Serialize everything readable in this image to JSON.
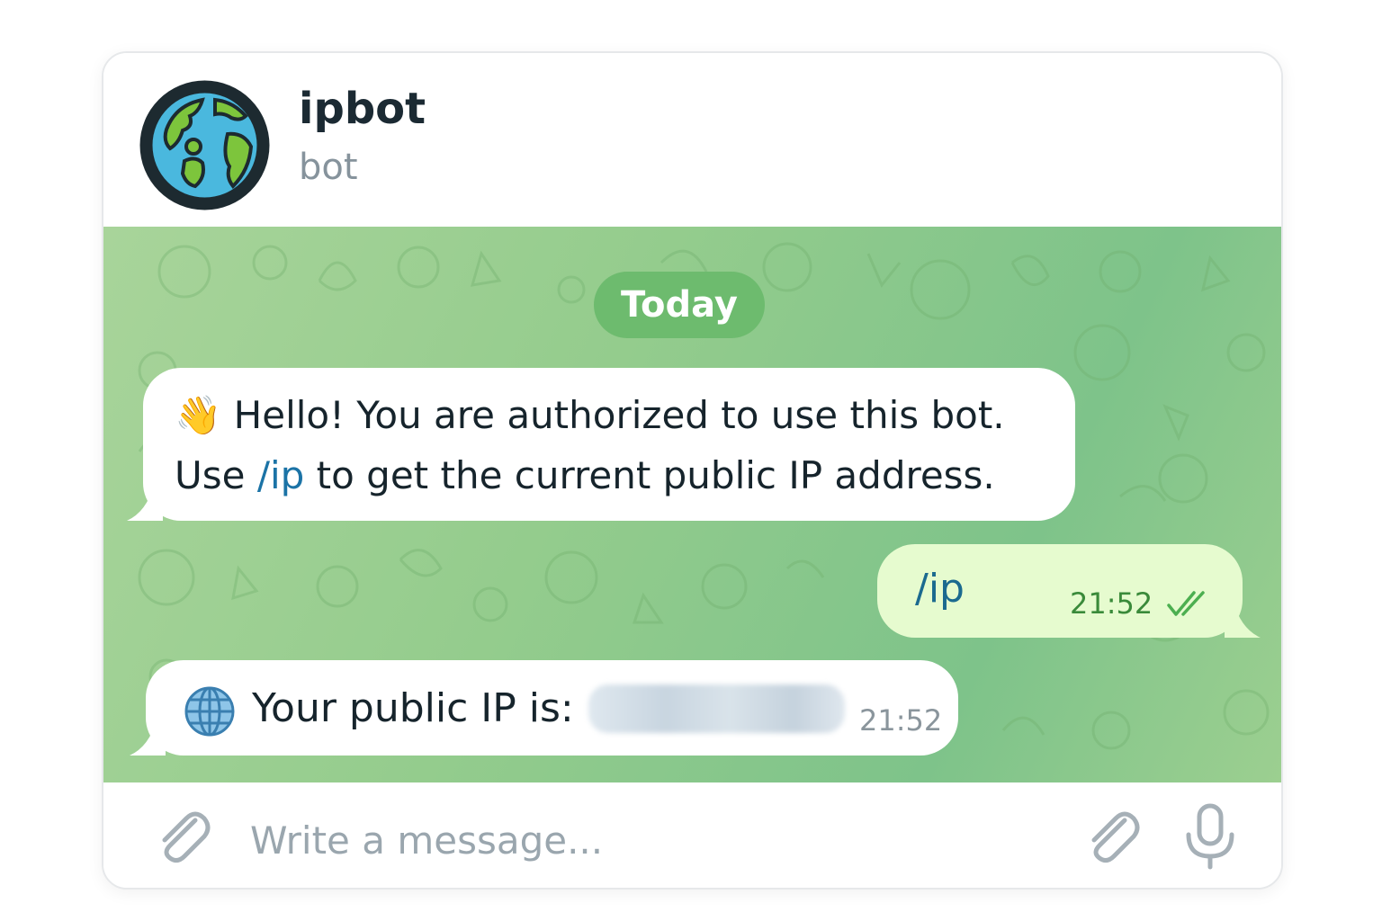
{
  "header": {
    "title": "ipbot",
    "subtitle": "bot",
    "avatar_icon": "earth-globe-icon"
  },
  "chat": {
    "date_label": "Today",
    "messages": [
      {
        "direction": "incoming",
        "emoji": "👋",
        "line1": "Hello! You are authorized to use this bot.",
        "line2_prefix": "Use ",
        "line2_command": "/ip",
        "line2_suffix": " to get the current public IP address."
      },
      {
        "direction": "outgoing",
        "text": "/ip",
        "time": "21:52",
        "status_icon": "double-check-icon"
      },
      {
        "direction": "incoming",
        "emoji_icon": "globe-meridians-icon",
        "text": "Your public IP is:",
        "redacted_value": true,
        "time": "21:52"
      }
    ]
  },
  "composer": {
    "placeholder": "Write a message...",
    "left_icon": "paperclip-icon",
    "right_icons": [
      "paperclip-icon",
      "microphone-icon"
    ]
  },
  "colors": {
    "chat_background": "#94cc8d",
    "outgoing_bubble": "#e6fbcf",
    "date_pill": "#6dbb6e",
    "link": "#1b73a6"
  }
}
